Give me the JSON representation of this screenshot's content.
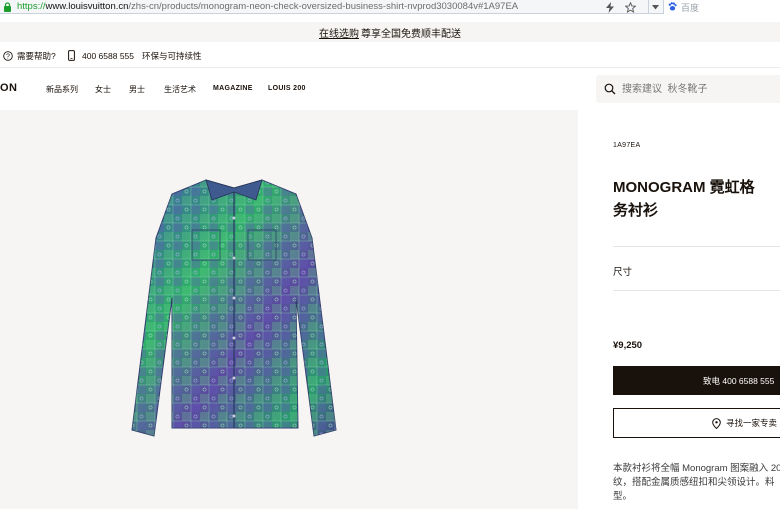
{
  "browser": {
    "url_scheme": "https://",
    "url_host": "www.louisvuitton.cn",
    "url_path": "/zhs-cn/products/monogram-neon-check-oversized-business-shirt-nvprod3030084v#1A97EA",
    "search_engine_placeholder": "百度"
  },
  "promo": {
    "link_text": "在线选购",
    "text": "尊享全国免费顺丰配送"
  },
  "utility": {
    "help": "需要帮助?",
    "phone": "400 6588 555",
    "sustainability": "环保与可持续性"
  },
  "nav": {
    "logo": "ON",
    "items": [
      "新品系列",
      "女士",
      "男士",
      "生活艺术",
      "MAGAZINE",
      "LOUIS 200"
    ],
    "search_placeholder": "搜索建议  秋冬靴子"
  },
  "product": {
    "sku": "1A97EA",
    "name_line1": "MONOGRAM 霓虹格",
    "name_line2": "务衬衫",
    "size_label": "尺寸",
    "price": "¥9,250",
    "call_button": "致电 400 6588 555",
    "store_button": "寻找一家专卖",
    "description_line1": "本款衬衫将全幅 Monogram 图案融入 20",
    "description_line2": "纹，搭配金属质感纽扣和尖领设计。料",
    "description_line3": "型。"
  },
  "colors": {
    "brand_dark": "#19110b",
    "panel_bg": "#f6f5f3",
    "url_green": "#1a9d2b",
    "shirt_green": "#2fae6a",
    "shirt_purple": "#5b4aa0"
  },
  "icons": {
    "address_bar": [
      "lock-icon",
      "flash-icon",
      "star-icon",
      "dropdown-icon",
      "baidu-paw-icon"
    ],
    "utility": [
      "help-icon",
      "phone-icon"
    ],
    "nav": [
      "search-icon"
    ],
    "product": [
      "location-pin-icon"
    ]
  }
}
